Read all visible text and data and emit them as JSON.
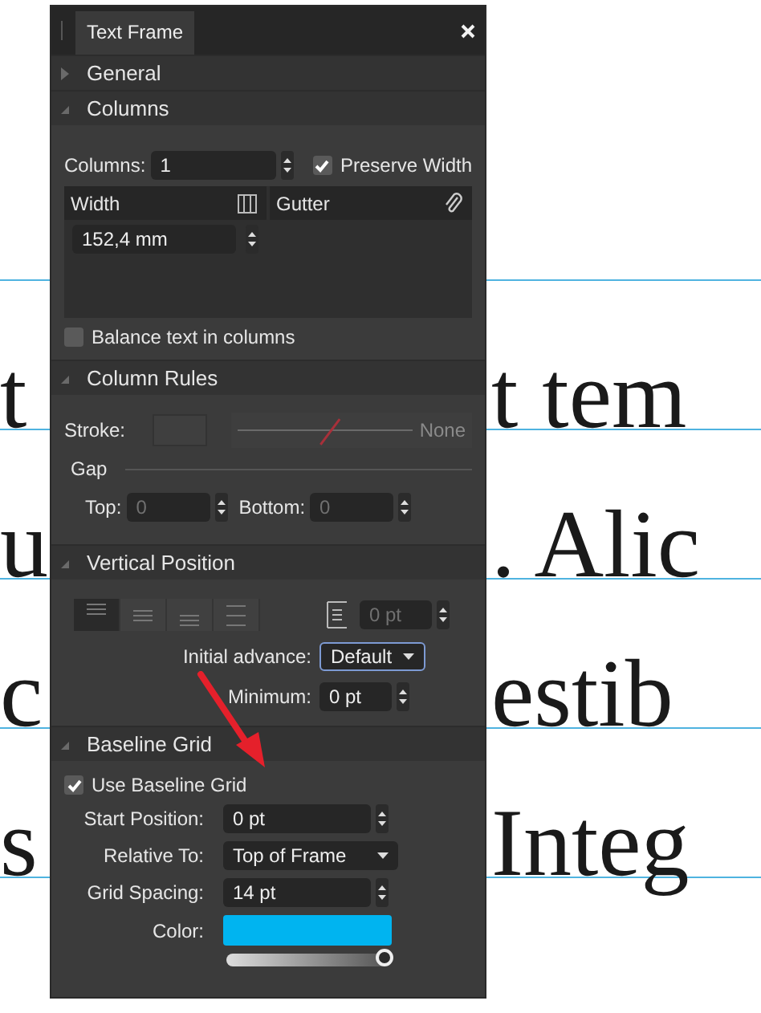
{
  "document": {
    "lines": [
      {
        "left": "t",
        "right": "t tem"
      },
      {
        "left": "u",
        "right": ". Alic"
      },
      {
        "left": "c",
        "right": "estib"
      },
      {
        "left": "s",
        "right": "Integ"
      }
    ]
  },
  "panel": {
    "title": "Text Frame"
  },
  "general": {
    "title": "General",
    "expanded": false
  },
  "columns": {
    "title": "Columns",
    "expanded": true,
    "label": "Columns:",
    "value": "1",
    "preserve_width": {
      "label": "Preserve Width",
      "checked": true
    },
    "width_header": "Width",
    "gutter_header": "Gutter",
    "width_value": "152,4 mm",
    "balance": {
      "label": "Balance text in columns",
      "checked": false
    }
  },
  "column_rules": {
    "title": "Column Rules",
    "expanded": true,
    "stroke_label": "Stroke:",
    "stroke_value": "None",
    "gap_label": "Gap",
    "top_label": "Top:",
    "top_value": "0",
    "bottom_label": "Bottom:",
    "bottom_value": "0",
    "disabled": true
  },
  "vertical_position": {
    "title": "Vertical Position",
    "expanded": true,
    "alignments": [
      {
        "kind": "top",
        "selected": true
      },
      {
        "kind": "center",
        "selected": false
      },
      {
        "kind": "bottom",
        "selected": false
      },
      {
        "kind": "justify",
        "selected": false
      }
    ],
    "offset_value": "0 pt",
    "offset_disabled": true,
    "initial_advance_label": "Initial advance:",
    "initial_advance_value": "Default",
    "minimum_label": "Minimum:",
    "minimum_value": "0 pt"
  },
  "baseline_grid": {
    "title": "Baseline Grid",
    "expanded": true,
    "use": {
      "label": "Use Baseline Grid",
      "checked": true
    },
    "start_label": "Start Position:",
    "start_value": "0 pt",
    "relative_label": "Relative To:",
    "relative_value": "Top of Frame",
    "spacing_label": "Grid Spacing:",
    "spacing_value": "14 pt",
    "color_label": "Color:",
    "color": "#00b4f0",
    "opacity": {
      "level": 1
    }
  }
}
